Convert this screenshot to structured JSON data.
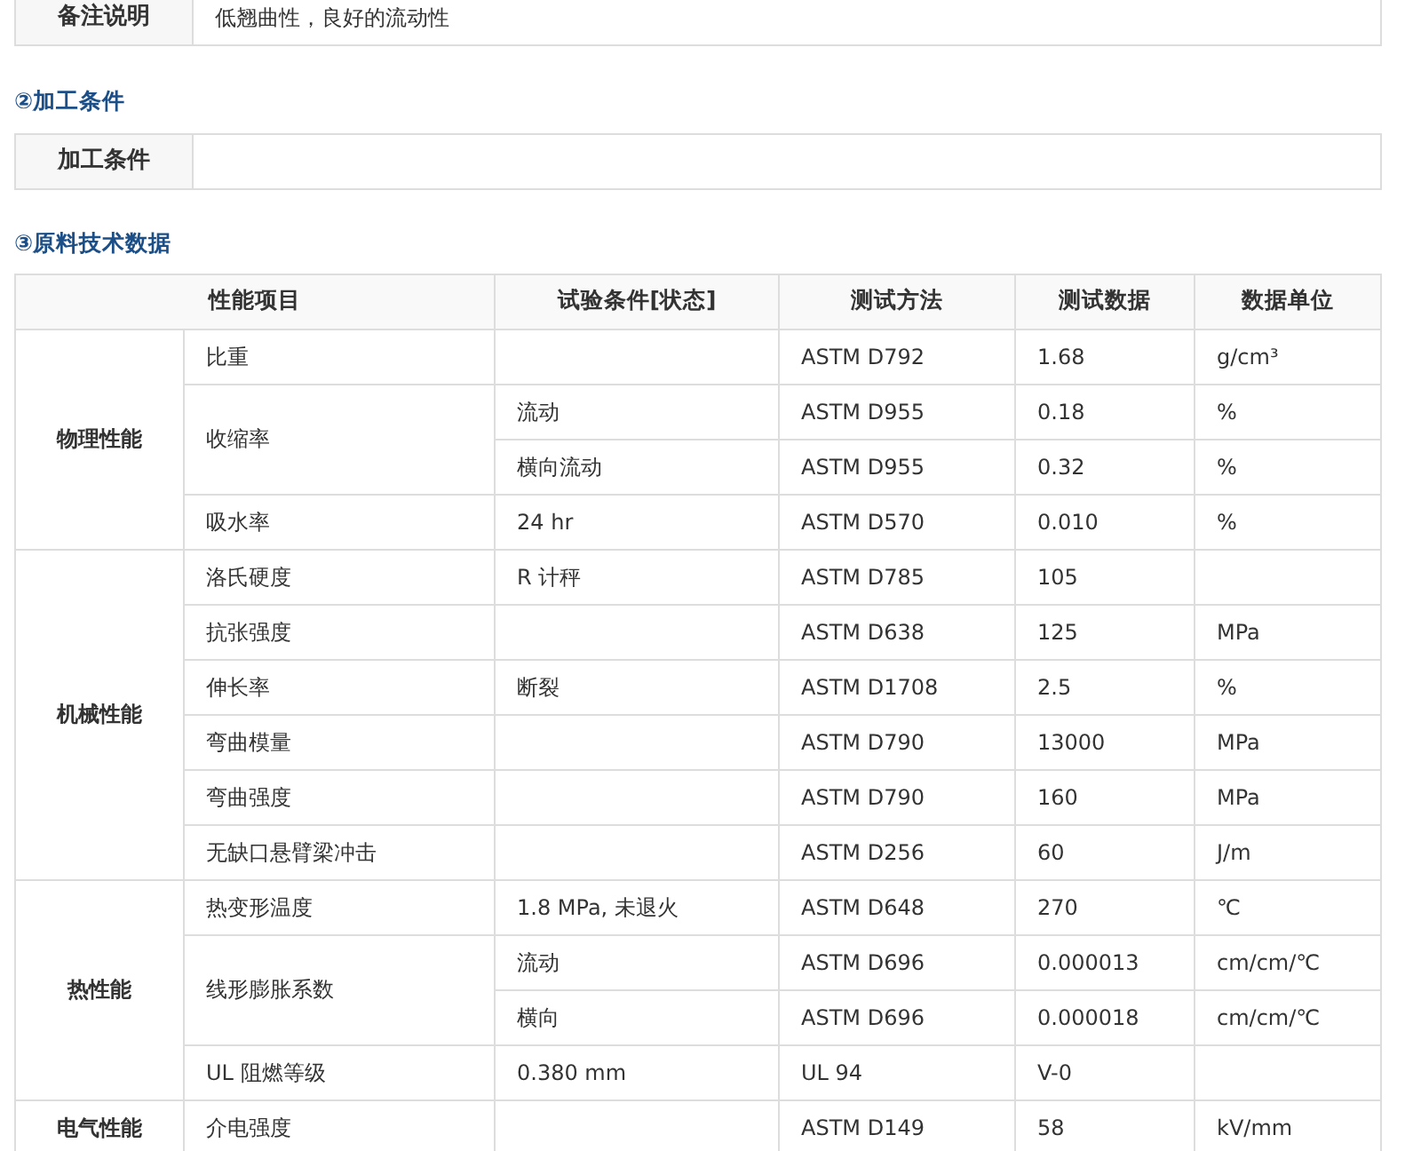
{
  "remarks": {
    "label": "备注说明",
    "value": "低翘曲性，良好的流动性"
  },
  "processing": {
    "heading": "②加工条件",
    "label": "加工条件"
  },
  "tech_data": {
    "heading": "③原料技术数据",
    "columns": [
      "性能项目",
      "试验条件[状态]",
      "测试方法",
      "测试数据",
      "数据单位"
    ],
    "groups": [
      {
        "name": "物理性能",
        "properties": [
          {
            "name": "比重",
            "tests": [
              {
                "method": "ASTM D792",
                "value": "1.68",
                "unit": "g/cm³"
              }
            ]
          },
          {
            "name": "收缩率",
            "tests": [
              {
                "condition": "流动",
                "method": "ASTM D955",
                "value": "0.18",
                "unit": "%"
              },
              {
                "condition": "横向流动",
                "method": "ASTM D955",
                "value": "0.32",
                "unit": "%"
              }
            ]
          },
          {
            "name": "吸水率",
            "tests": [
              {
                "condition": "24 hr",
                "method": "ASTM D570",
                "value": "0.010",
                "unit": "%"
              }
            ]
          }
        ]
      },
      {
        "name": "机械性能",
        "properties": [
          {
            "name": "洛氏硬度",
            "tests": [
              {
                "condition": "R 计秤",
                "method": "ASTM D785",
                "value": "105"
              }
            ]
          },
          {
            "name": "抗张强度",
            "tests": [
              {
                "method": "ASTM D638",
                "value": "125",
                "unit": "MPa"
              }
            ]
          },
          {
            "name": "伸长率",
            "tests": [
              {
                "condition": "断裂",
                "method": "ASTM D1708",
                "value": "2.5",
                "unit": "%"
              }
            ]
          },
          {
            "name": "弯曲模量",
            "tests": [
              {
                "method": "ASTM D790",
                "value": "13000",
                "unit": "MPa"
              }
            ]
          },
          {
            "name": "弯曲强度",
            "tests": [
              {
                "method": "ASTM D790",
                "value": "160",
                "unit": "MPa"
              }
            ]
          },
          {
            "name": "无缺口悬臂梁冲击",
            "tests": [
              {
                "method": "ASTM D256",
                "value": "60",
                "unit": "J/m"
              }
            ]
          }
        ]
      },
      {
        "name": "热性能",
        "properties": [
          {
            "name": "热变形温度",
            "tests": [
              {
                "condition": "1.8 MPa, 未退火",
                "method": "ASTM D648",
                "value": "270",
                "unit": "℃"
              }
            ]
          },
          {
            "name": "线形膨胀系数",
            "tests": [
              {
                "condition": "流动",
                "method": "ASTM D696",
                "value": "0.000013",
                "unit": "cm/cm/℃"
              },
              {
                "condition": "横向",
                "method": "ASTM D696",
                "value": "0.000018",
                "unit": "cm/cm/℃"
              }
            ]
          },
          {
            "name": "UL 阻燃等级",
            "tests": [
              {
                "condition": "0.380 mm",
                "method": "UL 94",
                "value": "V-0"
              }
            ]
          }
        ]
      },
      {
        "name": "电气性能",
        "properties": [
          {
            "name": "介电强度",
            "tests": [
              {
                "method": "ASTM D149",
                "value": "58",
                "unit": "kV/mm"
              }
            ]
          }
        ]
      }
    ]
  }
}
